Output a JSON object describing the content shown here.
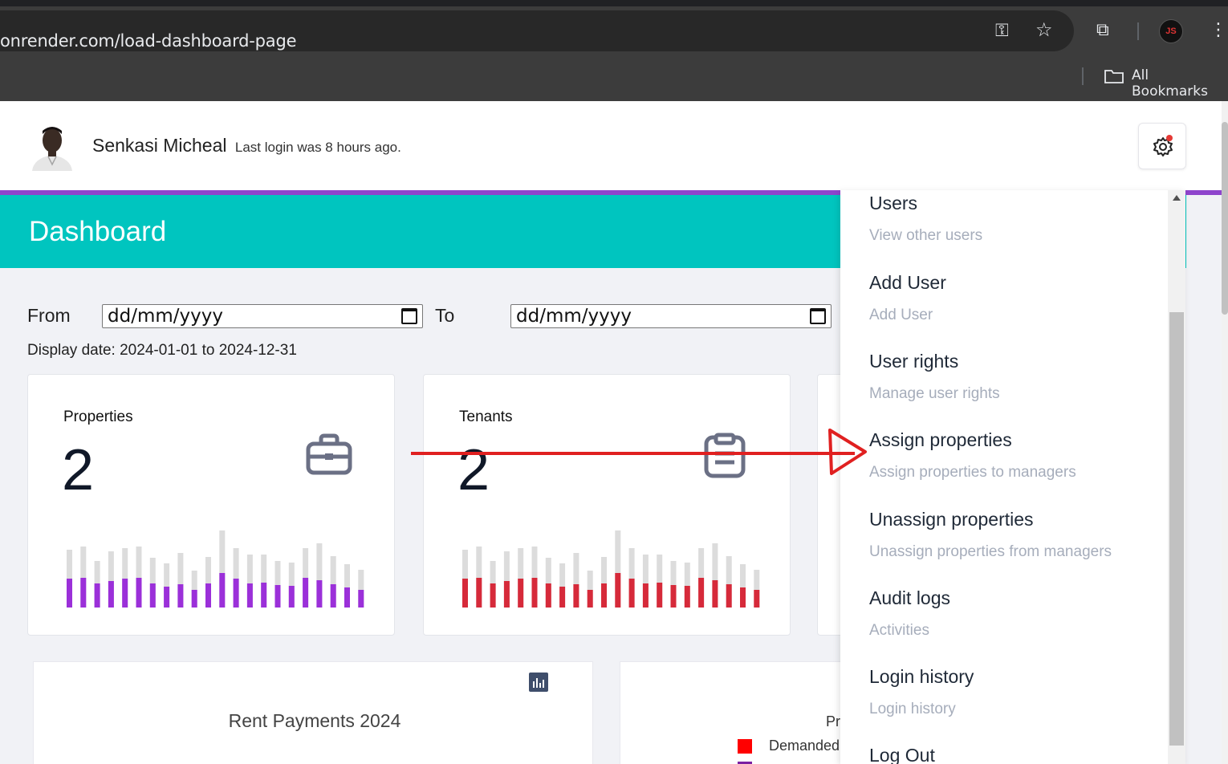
{
  "browser": {
    "url": "onrender.com/load-dashboard-page",
    "bookmarks_label": "All Bookmarks",
    "profile_initials": "JS"
  },
  "header": {
    "user_name": "Senkasi Micheal",
    "last_login": "Last login was 8 hours ago."
  },
  "dashboard": {
    "title": "Dashboard",
    "from_label": "From",
    "to_label": "To",
    "from_value": "dd/mm/yyyy",
    "to_value": "dd/mm/yyyy",
    "display_date": "Display date: 2024-01-01 to 2024-12-31"
  },
  "cards": [
    {
      "title": "Properties",
      "value": "2",
      "icon": "briefcase-icon",
      "bar_color": "#9b30d9"
    },
    {
      "title": "Tenants",
      "value": "2",
      "icon": "clipboard-icon",
      "bar_color": "#d62a3a"
    }
  ],
  "lower": {
    "rent_title": "Rent Payments 2024",
    "pr_label": "Pr",
    "legend_demanded": "Demanded"
  },
  "menu": {
    "items": [
      {
        "title": "Users",
        "sub": "View other users"
      },
      {
        "title": "Add User",
        "sub": "Add User"
      },
      {
        "title": "User rights",
        "sub": "Manage user rights"
      },
      {
        "title": "Assign properties",
        "sub": "Assign properties to managers"
      },
      {
        "title": "Unassign properties",
        "sub": "Unassign properties from managers"
      },
      {
        "title": "Audit logs",
        "sub": "Activities"
      },
      {
        "title": "Login history",
        "sub": "Login history"
      },
      {
        "title": "Log Out",
        "sub": ""
      }
    ]
  },
  "colors": {
    "accent": "#00c5bf",
    "purple_bar": "#8e44cc",
    "annotation_arrow": "#e02020"
  }
}
